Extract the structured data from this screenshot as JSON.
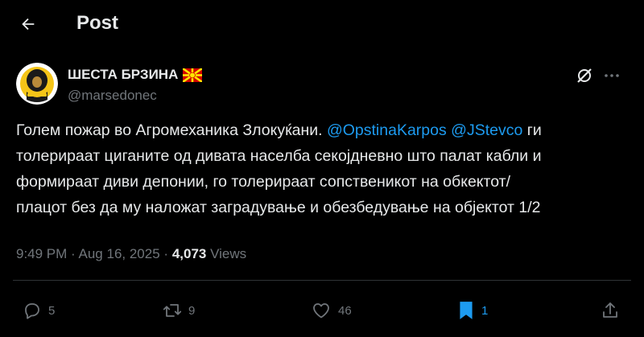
{
  "header": {
    "title": "Post"
  },
  "author": {
    "display_name": "ШЕСТА БРЗИНА",
    "flag_icon": "north-macedonia-flag-icon",
    "handle": "@marsedonec"
  },
  "tweet": {
    "line1_pre": "Голем пожар во Агромеханика Злокуќани. ",
    "mention1": "@OpstinaKarpos",
    "mention2": "@JStevco",
    "line1_post": " ги",
    "line2": "толерираат циганите од дивата населба секојдневно што палат кабли и",
    "line3": "формираат диви депонии, го толерираат сопственикот на обкектот/",
    "line4": "плацот без да му наложат заградување и обезбедување на објектот 1/2"
  },
  "meta": {
    "time": "9:49 PM",
    "sep": "·",
    "date": "Aug 16, 2025",
    "views_count": "4,073",
    "views_label": "Views"
  },
  "actions": {
    "reply_count": "5",
    "retweet_count": "9",
    "like_count": "46",
    "bookmark_count": "1"
  },
  "colors": {
    "accent": "#1d9bf0",
    "text": "#e7e9ea",
    "muted": "#71767b",
    "background": "#000000"
  }
}
